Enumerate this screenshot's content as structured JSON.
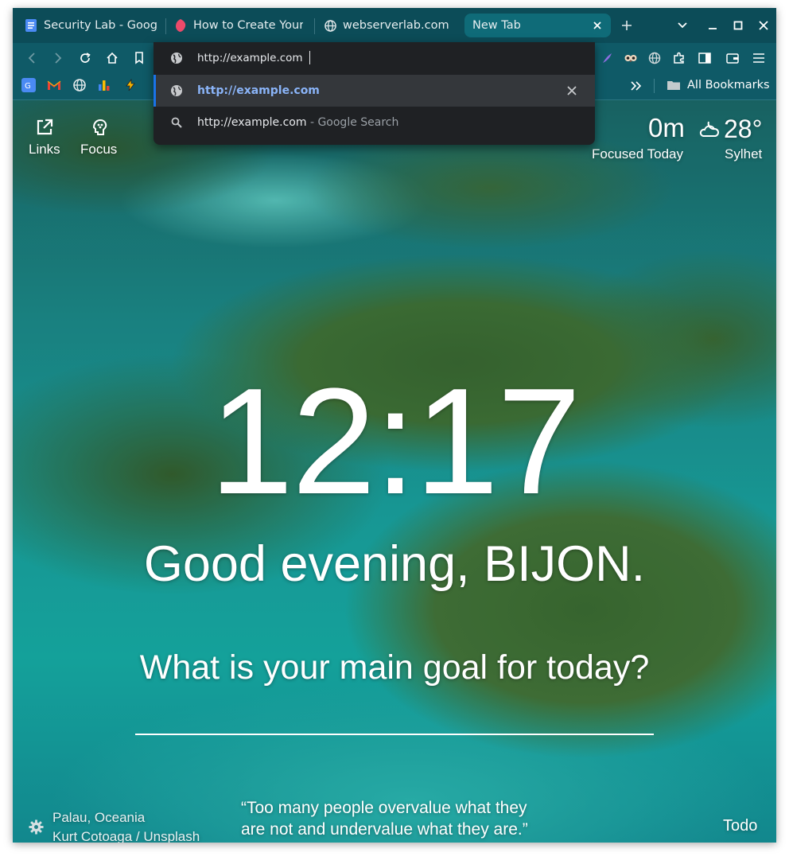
{
  "tabs": [
    {
      "label": "Security Lab - Google Docs",
      "icon": "google-docs-icon"
    },
    {
      "label": "How to Create Your Own",
      "icon": "app-favicon-icon"
    },
    {
      "label": "webserverlab.com",
      "icon": "globe-icon"
    },
    {
      "label": "New Tab",
      "icon": "",
      "active": true
    }
  ],
  "omnibox": {
    "input_value": "http://example.com",
    "suggestions": [
      {
        "text": "http://example.com",
        "suffix": "",
        "icon": "globe-icon"
      },
      {
        "text": "http://example.com",
        "suffix": " - Google Search",
        "icon": "search-icon"
      }
    ]
  },
  "bookmarks": {
    "all_label": "All Bookmarks"
  },
  "newtab": {
    "links_label": "Links",
    "focus_label": "Focus",
    "focused_value": "0m",
    "focused_label": "Focused Today",
    "temperature": "28°",
    "city": "Sylhet",
    "clock": "12:17",
    "greeting": "Good evening, BIJON.",
    "goal_prompt": "What is your main goal for today?",
    "location": "Palau, Oceania",
    "photo_credit": "Kurt Cotoaga / Unsplash",
    "quote_line1": "“Too many people overvalue what they",
    "quote_line2": "are not and undervalue what they are.”",
    "todo_label": "Todo"
  },
  "colors": {
    "tabstrip": "#0c4c58",
    "toolbar": "#0f5a67",
    "active_tab": "#0f6b78",
    "omnibox_bg": "#1f2124",
    "link_blue": "#8ab4f8",
    "selection_accent": "#1a73e8"
  }
}
